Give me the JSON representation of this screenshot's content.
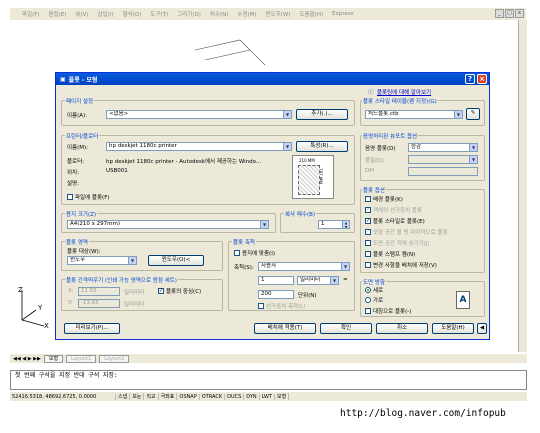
{
  "menubar": {
    "items": [
      "파일(F)",
      "편집(E)",
      "뷰(V)",
      "삽입(I)",
      "형식(O)",
      "도구(T)",
      "그리기(D)",
      "치수(N)",
      "수정(M)",
      "윈도우(W)",
      "도움말(H)",
      "Express"
    ]
  },
  "window_buttons": [
    "_",
    "□",
    "x"
  ],
  "tabs": {
    "items": [
      "모형",
      "Layout1",
      "Layout2"
    ]
  },
  "command_line": {
    "line1": "첫 번째 구석을 지정 반대 구석 지정:",
    "line2": ""
  },
  "status_bar": {
    "coords": "52416.5318, 48692.6725, 0.0000",
    "toggles": [
      "스냅",
      "모눈",
      "직교",
      "극좌표",
      "OSNAP",
      "OTRACK",
      "DUCS",
      "DYN",
      "LWT",
      "모형"
    ]
  },
  "watermark": "http://blog.naver.com/infopub",
  "dialog": {
    "title": "플롯 - 모형",
    "help_link": "플롯팅에 대해 알아보기",
    "page_setup": {
      "group": "페이지 설정",
      "name_label": "이름(A):",
      "name_value": "<없음>",
      "add_button": "추가(.)..."
    },
    "printer": {
      "group": "프린터/플로터",
      "name_label": "이름(M):",
      "name_value": "hp deskjet 1180c printer",
      "properties_button": "특성(R)...",
      "plotter_label": "플로터:",
      "plotter_value": "hp deskjet 1180c printer - Autodesk에서 제공하는 Windo...",
      "where_label": "위치:",
      "where_value": "USB001",
      "desc_label": "설명:",
      "desc_value": "",
      "plot_to_file": "파일에 플롯(F)",
      "preview_width": "210 MM",
      "preview_height": "297 MM"
    },
    "paper_size": {
      "group": "용지 크기(Z)",
      "value": "A4(210 x 297mm)"
    },
    "copies": {
      "group": "복사 매수(B)",
      "value": "1"
    },
    "plot_area": {
      "group": "플롯 영역",
      "what_label": "플롯 대상(W):",
      "what_value": "윈도우",
      "window_button": "윈도우(O)<"
    },
    "plot_offset": {
      "group": "플롯 간격띄우기 (인쇄 가능 영역으로 원점 세트)",
      "x_label": "X:",
      "x_value": "11.55",
      "x_unit": "밀리미터",
      "y_label": "Y:",
      "y_value": "-13.65",
      "y_unit": "밀리미터",
      "center": "플롯의 중심(C)"
    },
    "plot_scale": {
      "group": "플롯 축척",
      "fit": "용지에 맞춤(I)",
      "scale_label": "축척(S):",
      "scale_value": "사용자",
      "value1": "1",
      "unit1": "밀리미터",
      "equals": "=",
      "value2": "200",
      "unit2": "단위(N)",
      "lineweights": "선가중치 축척(L)"
    },
    "plot_style_table": {
      "group": "플롯 스타일 테이블(펜 지정)(G)",
      "value": "처드플롯.ctb"
    },
    "shaded_viewport": {
      "group": "음영처리된 뷰포트 옵션",
      "shade_label": "음영 플롯(D)",
      "shade_value": "승감",
      "quality_label": "품질(Q)",
      "quality_value": "",
      "dpi_label": "DPI",
      "dpi_value": ""
    },
    "plot_options": {
      "group": "플롯 옵션",
      "items": [
        {
          "label": "배경 플롯(K)",
          "checked": false,
          "enabled": true
        },
        {
          "label": "객체의 선가중치 플롯",
          "checked": true,
          "enabled": false
        },
        {
          "label": "플롯 스타일로 플롯(E)",
          "checked": true,
          "enabled": true
        },
        {
          "label": "모형 공간 을 맨 마지막으로 플롯",
          "checked": true,
          "enabled": false
        },
        {
          "label": "도면 공간 객체 숨기기(J)",
          "checked": false,
          "enabled": false
        },
        {
          "label": "플롯 스탬프 켬(N)",
          "checked": false,
          "enabled": true
        },
        {
          "label": "변경 사항을 배치에 저장(V)",
          "checked": false,
          "enabled": true
        }
      ]
    },
    "orientation": {
      "group": "도면 방향",
      "portrait": "세로",
      "landscape": "가로",
      "upside_down": "대칭으로 플롯(-)",
      "icon_letter": "A"
    },
    "footer": {
      "preview": "미리보기(P)...",
      "apply": "배치에 적용(T)",
      "ok": "확인",
      "cancel": "취소",
      "help": "도움말(H)"
    }
  }
}
